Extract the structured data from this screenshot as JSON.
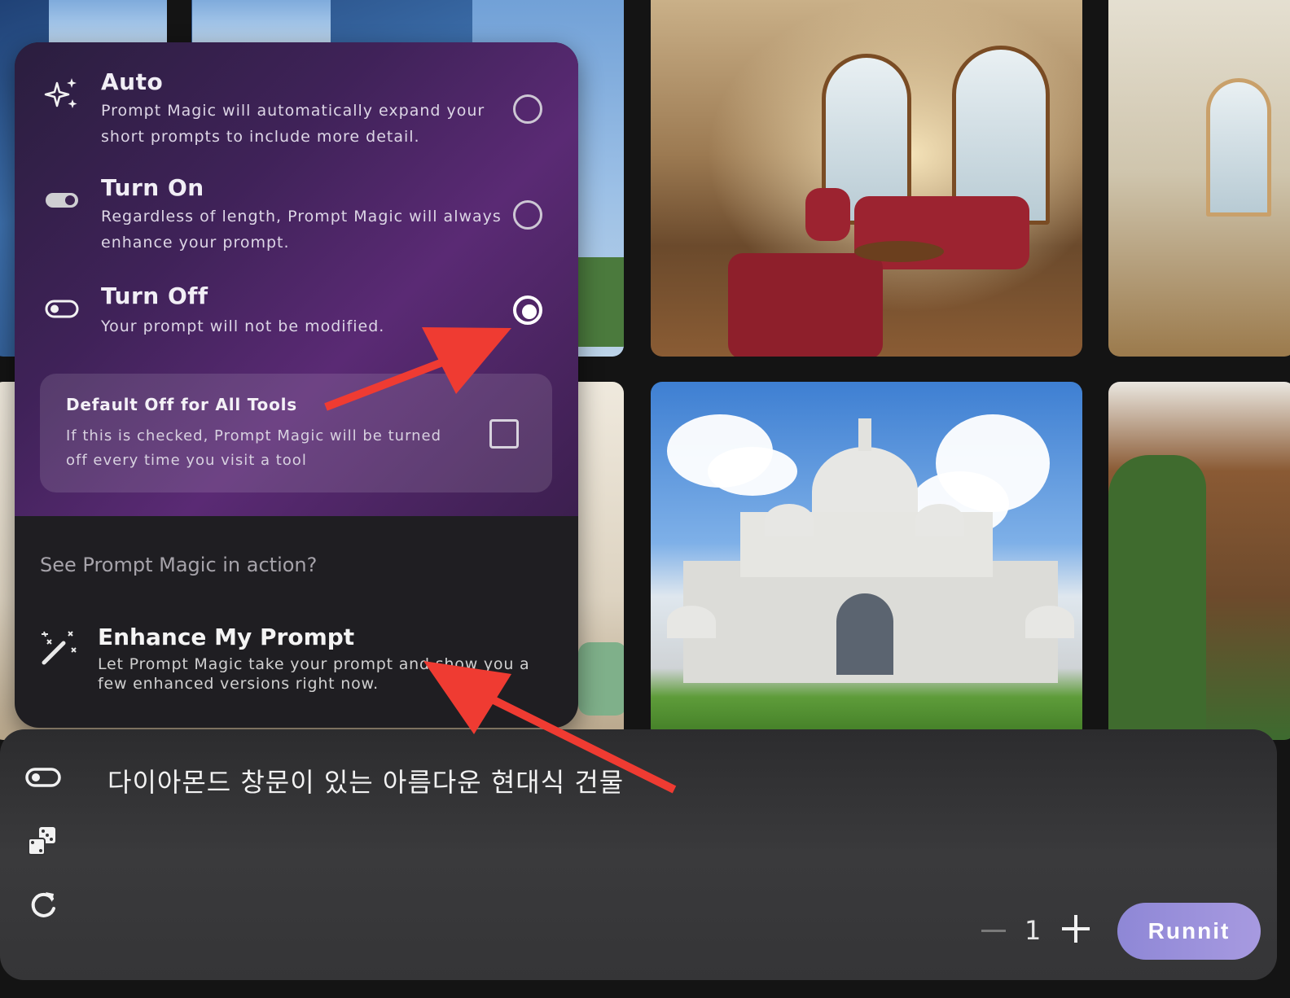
{
  "popup": {
    "options": [
      {
        "title": "Auto",
        "description": "Prompt Magic will automatically expand your short prompts to include more detail.",
        "icon": "sparkles-icon",
        "selected": false
      },
      {
        "title": "Turn On",
        "description": "Regardless of length, Prompt Magic will always enhance your prompt.",
        "icon": "toggle-on-icon",
        "selected": false
      },
      {
        "title": "Turn Off",
        "description": "Your prompt will not be modified.",
        "icon": "toggle-off-icon",
        "selected": true
      }
    ],
    "default_off": {
      "title": "Default Off for All Tools",
      "description": "If this is checked, Prompt Magic will be turned off every time you visit a tool",
      "checked": false
    },
    "see_in_action": "See Prompt Magic in action?",
    "enhance": {
      "title": "Enhance My Prompt",
      "description": "Let Prompt Magic take your prompt and show you a few enhanced versions right now.",
      "icon": "magic-wand-icon"
    }
  },
  "prompt_bar": {
    "prompt_text": "다이아몬드 창문이 있는 아름다운 현대식 건물",
    "icons": [
      "toggle-off-icon",
      "dice-icon",
      "refresh-icon"
    ],
    "count": "1",
    "run_label": "Runnit"
  },
  "colors": {
    "accent": "#9b90dc",
    "popup_gradient": "#5a2a74",
    "annotation_arrow": "#ef3b32"
  }
}
